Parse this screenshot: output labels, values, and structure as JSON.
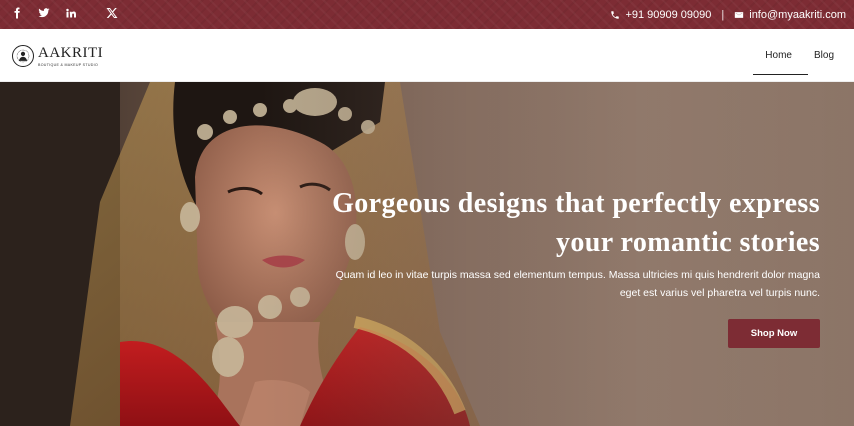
{
  "topbar": {
    "social": [
      {
        "icon": "facebook-icon"
      },
      {
        "icon": "twitter-icon"
      },
      {
        "icon": "linkedin-icon"
      },
      {
        "icon": "x-icon"
      }
    ],
    "phone": "+91 90909 09090",
    "separator": "|",
    "email": "info@myaakriti.com",
    "background": "#7d2c34"
  },
  "header": {
    "logo_name": "AAKRITI",
    "logo_tagline": "BOUTIQUE & MAKEUP STUDIO",
    "nav": [
      {
        "label": "Home",
        "active": true
      },
      {
        "label": "Blog",
        "active": false
      }
    ]
  },
  "hero": {
    "title_line1": "Gorgeous designs that perfectly express",
    "title_line2": "your romantic stories",
    "subtitle_line1": "Quam id leo in vitae turpis massa sed elementum tempus. Massa ultricies mi quis hendrerit dolor magna",
    "subtitle_line2": "eget est varius vel pharetra vel turpis nunc.",
    "button_label": "Shop Now",
    "accent": "#7d2c34"
  }
}
